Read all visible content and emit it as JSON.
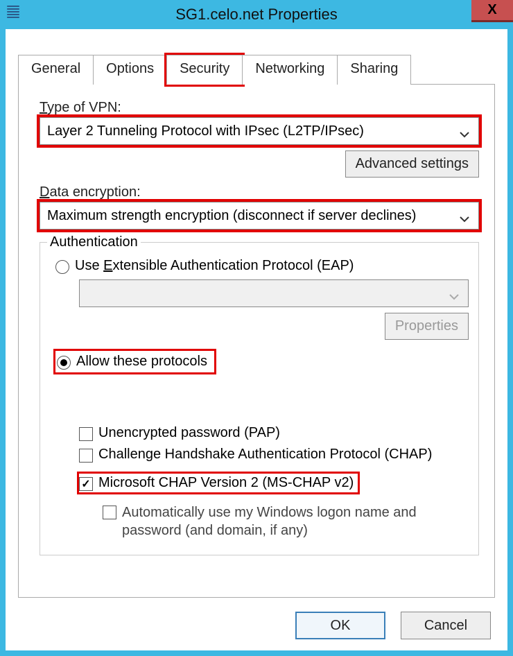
{
  "titlebar": {
    "title": "SG1.celo.net Properties",
    "close": "X"
  },
  "tabs": [
    {
      "label": "General"
    },
    {
      "label": "Options"
    },
    {
      "label": "Security"
    },
    {
      "label": "Networking"
    },
    {
      "label": "Sharing"
    }
  ],
  "security": {
    "type_label": "Type of VPN:",
    "type_value": "Layer 2 Tunneling Protocol with IPsec (L2TP/IPsec)",
    "advanced_btn": "Advanced settings",
    "data_enc_label": "Data encryption:",
    "data_enc_value": "Maximum strength encryption (disconnect if server declines)",
    "auth_legend": "Authentication",
    "eap_label": "Use Extensible Authentication Protocol (EAP)",
    "properties_btn": "Properties",
    "allow_label": "Allow these protocols",
    "pap_label": "Unencrypted password (PAP)",
    "chap_label": "Challenge Handshake Authentication Protocol (CHAP)",
    "mschap_label": "Microsoft CHAP Version 2 (MS-CHAP v2)",
    "autologon_label": "Automatically use my Windows logon name and password (and domain, if any)"
  },
  "footer": {
    "ok": "OK",
    "cancel": "Cancel"
  }
}
